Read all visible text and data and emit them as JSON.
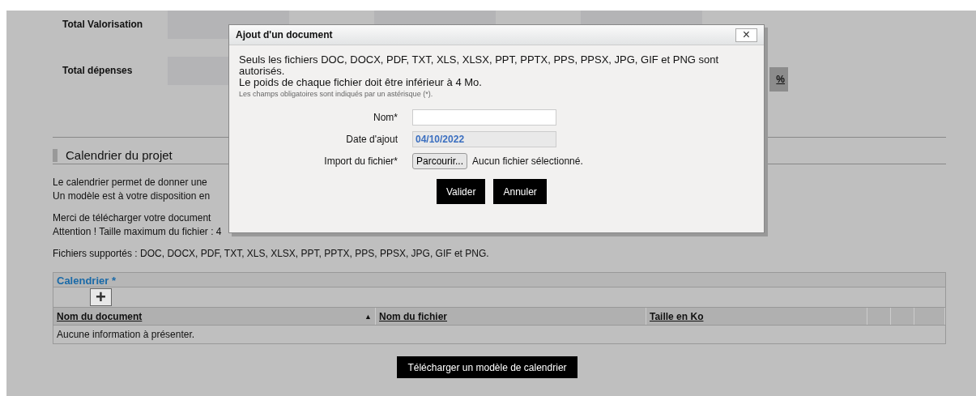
{
  "totals": [
    {
      "label": "Total Valorisation"
    },
    {
      "label": "Total dépenses",
      "link": "%"
    }
  ],
  "section": {
    "title": "Calendrier du projet",
    "paragraphs": [
      [
        "Le calendrier permet de donner une",
        "Un modèle est à votre disposition en"
      ],
      [
        "Merci de télécharger votre document",
        "Attention ! Taille maximum du fichier : 4"
      ],
      [
        "Fichiers supportés : DOC, DOCX, PDF, TXT, XLS, XLSX, PPT, PPTX, PPS, PPSX, JPG, GIF et PNG."
      ]
    ]
  },
  "table": {
    "title": "Calendrier *",
    "add_button": "+",
    "columns": [
      {
        "label": "Nom du document",
        "sort": "▲"
      },
      {
        "label": "Nom du fichier"
      },
      {
        "label": "Taille en Ko"
      }
    ],
    "empty_message": "Aucune information à présenter."
  },
  "download_button": "Télécharger un modèle de calendrier",
  "dialog": {
    "title": "Ajout d'un document",
    "close": "×",
    "info": [
      "Seuls les fichiers DOC, DOCX, PDF, TXT, XLS, XLSX, PPT, PPTX, PPS, PPSX, JPG, GIF et PNG sont autorisés.",
      "Le poids de chaque fichier doit être inférieur à 4 Mo."
    ],
    "hint": "Les champs obligatoires sont indiqués par un astérisque (*).",
    "fields": [
      {
        "kind": "text",
        "label": "Nom*",
        "disabled": false
      },
      {
        "kind": "text",
        "label": "Date d'ajout",
        "value": "04/10/2022",
        "disabled": true
      },
      {
        "kind": "file",
        "label": "Import du fichier*",
        "button": "Parcourir...",
        "status": "Aucun fichier sélectionné."
      }
    ],
    "buttons": [
      "Valider",
      "Annuler"
    ]
  }
}
